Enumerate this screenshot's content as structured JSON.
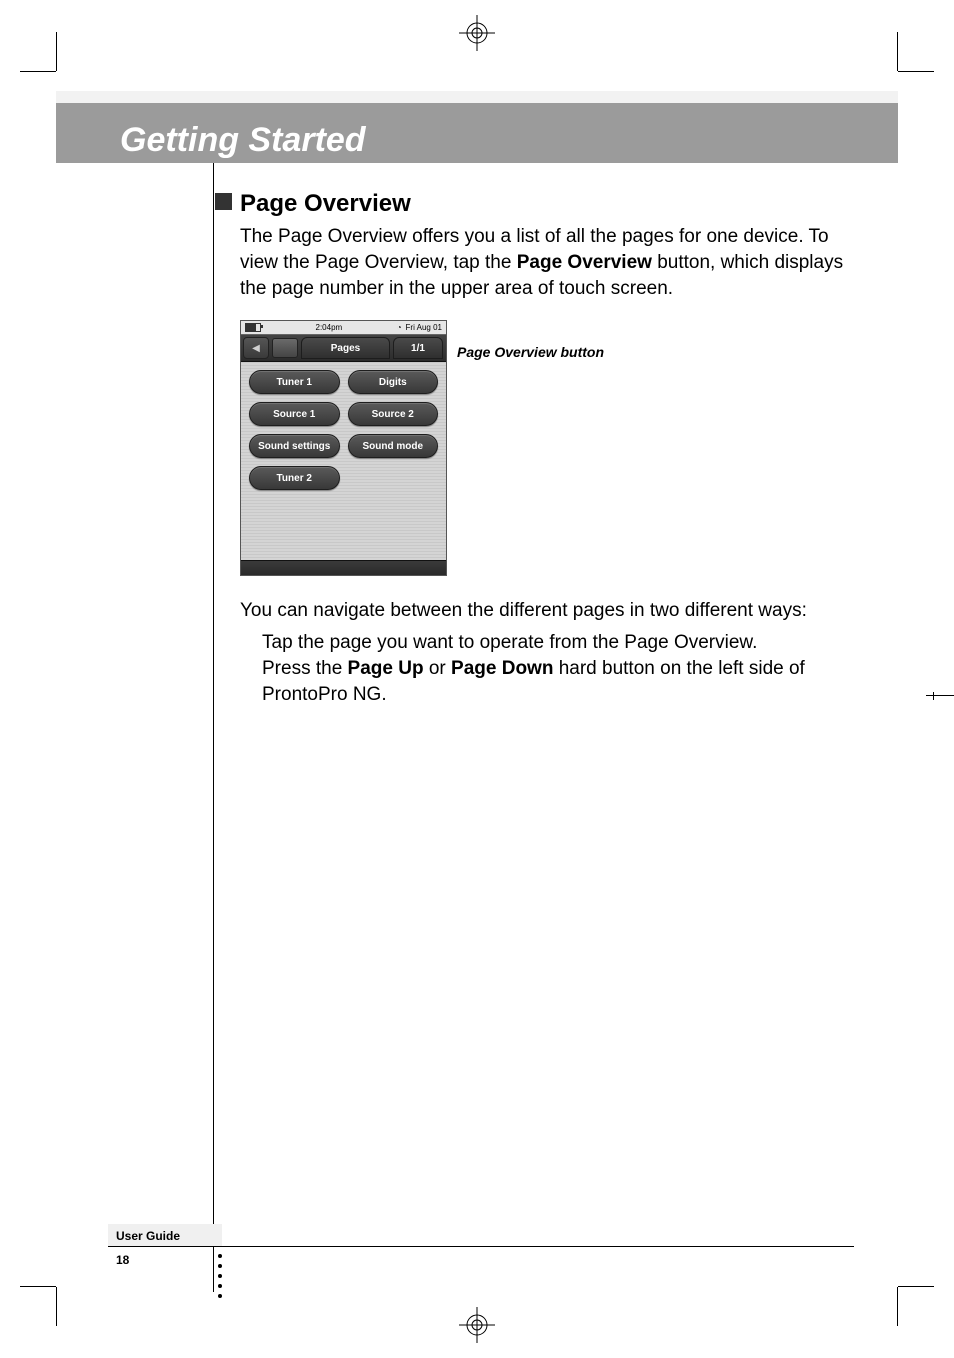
{
  "header": {
    "chapter_title": "Getting Started"
  },
  "section": {
    "heading": "Page Overview",
    "intro_before_bold": "The Page Overview offers you a list of all the pages for one device. To view the Page Overview, tap the ",
    "intro_bold": "Page Overview",
    "intro_after_bold": " button, which displays the page number in the upper area of touch screen."
  },
  "device": {
    "status": {
      "time": "2:04pm",
      "date": "Fri Aug 01"
    },
    "tab_left_icon": "◀",
    "tab_label": "Pages",
    "page_counter": "1/1",
    "buttons": [
      "Tuner 1",
      "Digits",
      "Source 1",
      "Source 2",
      "Sound settings",
      "Sound mode",
      "Tuner 2"
    ]
  },
  "callout": {
    "label": "Page Overview button"
  },
  "navigate": {
    "lead": "You can navigate between the different pages in two different ways:",
    "way1": "Tap the page you want to operate from the Page Overview.",
    "way2_before": "Press the ",
    "way2_b1": "Page Up",
    "way2_mid": " or ",
    "way2_b2": "Page Down",
    "way2_after": " hard button on the left side of ProntoPro NG."
  },
  "footer": {
    "label": "User Guide",
    "page": "18"
  }
}
